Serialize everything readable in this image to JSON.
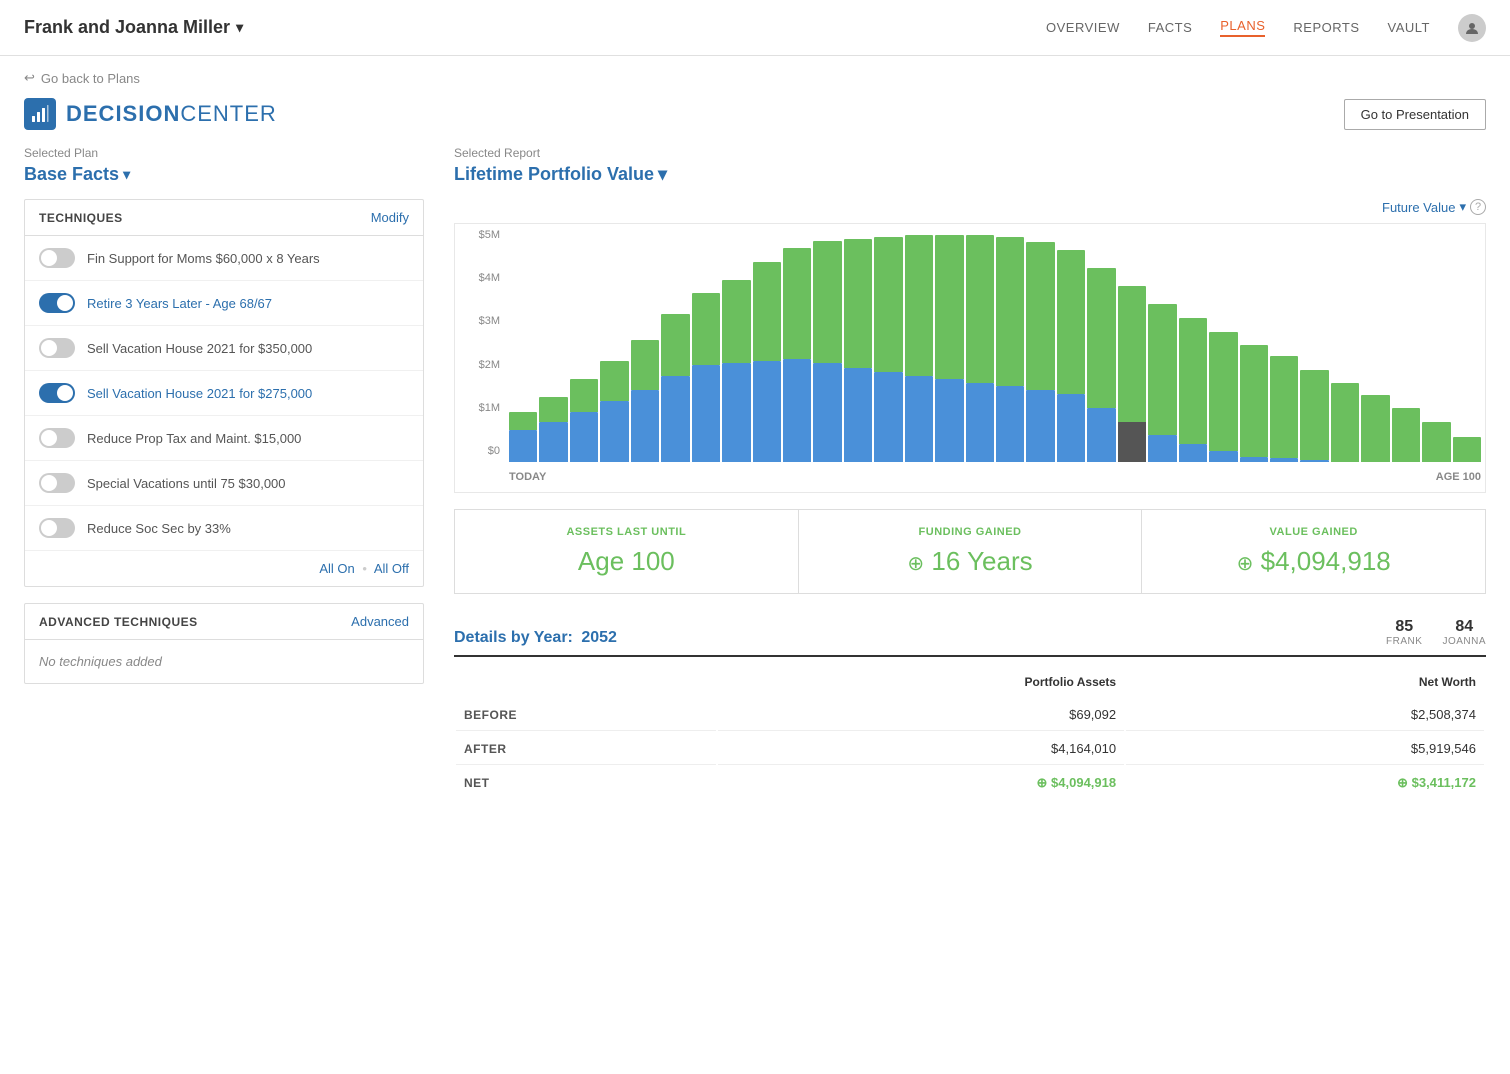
{
  "app": {
    "client_name": "Frank and Joanna Miller",
    "nav_items": [
      {
        "label": "OVERVIEW",
        "active": false
      },
      {
        "label": "FACTS",
        "active": false
      },
      {
        "label": "PLANS",
        "active": true
      },
      {
        "label": "REPORTS",
        "active": false
      },
      {
        "label": "VAULT",
        "active": false
      }
    ]
  },
  "breadcrumb": {
    "text": "Go back to Plans"
  },
  "dc": {
    "title_bold": "DECISION",
    "title_light": "CENTER",
    "btn_presentation": "Go to Presentation"
  },
  "left_panel": {
    "selected_plan_label": "Selected Plan",
    "plan_name": "Base Facts",
    "techniques_title": "TECHNIQUES",
    "modify_label": "Modify",
    "techniques": [
      {
        "label": "Fin Support for Moms $60,000 x 8 Years",
        "on": false,
        "active": false
      },
      {
        "label": "Retire 3 Years Later - Age 68/67",
        "on": true,
        "active": true
      },
      {
        "label": "Sell Vacation House 2021 for $350,000",
        "on": false,
        "active": false
      },
      {
        "label": "Sell Vacation House 2021 for $275,000",
        "on": true,
        "active": true
      },
      {
        "label": "Reduce Prop Tax and Maint. $15,000",
        "on": false,
        "active": false
      },
      {
        "label": "Special Vacations until 75 $30,000",
        "on": false,
        "active": false
      },
      {
        "label": "Reduce Soc Sec by 33%",
        "on": false,
        "active": false
      }
    ],
    "all_on": "All On",
    "dot": "•",
    "all_off": "All Off",
    "advanced_title": "ADVANCED TECHNIQUES",
    "advanced_label": "Advanced",
    "no_techniques": "No techniques added"
  },
  "right_panel": {
    "selected_report_label": "Selected Report",
    "report_name": "Lifetime Portfolio Value",
    "future_value_label": "Future Value",
    "chart_y_labels": [
      "$5M",
      "$4M",
      "$3M",
      "$2M",
      "$1M",
      "$0"
    ],
    "chart_x_start": "TODAY",
    "chart_x_end": "AGE 100",
    "summary_cards": [
      {
        "label": "ASSETS LAST UNTIL",
        "value": "Age 100",
        "has_plus": false
      },
      {
        "label": "FUNDING GAINED",
        "value": "16 Years",
        "has_plus": true
      },
      {
        "label": "VALUE GAINED",
        "value": "$4,094,918",
        "has_plus": true
      }
    ],
    "details_label": "Details by Year:",
    "details_year": "2052",
    "frank_age": "85",
    "frank_label": "FRANK",
    "joanna_age": "84",
    "joanna_label": "JOANNA",
    "table_headers": [
      "Portfolio Assets",
      "Net Worth"
    ],
    "table_rows": [
      {
        "label": "BEFORE",
        "portfolio": "$69,092",
        "net_worth": "$2,508,374",
        "green": false
      },
      {
        "label": "AFTER",
        "portfolio": "$4,164,010",
        "net_worth": "$5,919,546",
        "green": false
      },
      {
        "label": "NET",
        "portfolio": "$4,094,918",
        "net_worth": "$3,411,172",
        "green": true
      }
    ]
  },
  "chart_bars": [
    {
      "blue": 18,
      "green": 10
    },
    {
      "blue": 22,
      "green": 14
    },
    {
      "blue": 28,
      "green": 18
    },
    {
      "blue": 34,
      "green": 22
    },
    {
      "blue": 40,
      "green": 28
    },
    {
      "blue": 48,
      "green": 34
    },
    {
      "blue": 54,
      "green": 40
    },
    {
      "blue": 55,
      "green": 46
    },
    {
      "blue": 56,
      "green": 55
    },
    {
      "blue": 57,
      "green": 62
    },
    {
      "blue": 55,
      "green": 68
    },
    {
      "blue": 52,
      "green": 72
    },
    {
      "blue": 50,
      "green": 75
    },
    {
      "blue": 48,
      "green": 78
    },
    {
      "blue": 46,
      "green": 80
    },
    {
      "blue": 44,
      "green": 82
    },
    {
      "blue": 42,
      "green": 83
    },
    {
      "blue": 40,
      "green": 82
    },
    {
      "blue": 38,
      "green": 80
    },
    {
      "blue": 30,
      "green": 78
    },
    {
      "blue": 22,
      "green": 76
    },
    {
      "blue": 15,
      "green": 73
    },
    {
      "blue": 10,
      "green": 70
    },
    {
      "blue": 6,
      "green": 66
    },
    {
      "blue": 3,
      "green": 62
    },
    {
      "blue": 2,
      "green": 57
    },
    {
      "blue": 1,
      "green": 50
    },
    {
      "blue": 0,
      "green": 44
    },
    {
      "blue": 0,
      "green": 37
    },
    {
      "blue": 0,
      "green": 30
    },
    {
      "blue": 0,
      "green": 22
    },
    {
      "blue": 0,
      "green": 14
    }
  ]
}
